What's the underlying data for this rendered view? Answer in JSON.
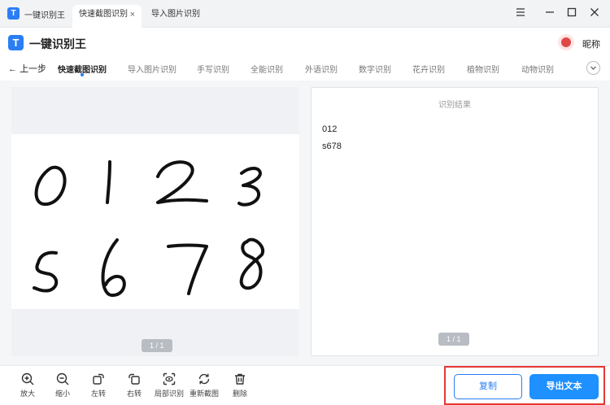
{
  "window": {
    "title": "一键识别王",
    "tabs": [
      {
        "label": "快速截图识别",
        "active": true
      },
      {
        "label": "导入图片识别",
        "active": false
      }
    ],
    "close_tab_glyph": "×"
  },
  "header": {
    "app_name": "一键识别王",
    "logo_letter": "T",
    "nickname": "昵称"
  },
  "nav": {
    "back_label": "上一步",
    "tabs": [
      "快速截图识别",
      "导入图片识别",
      "手写识别",
      "全能识别",
      "外语识别",
      "数字识别",
      "花卉识别",
      "植物识别",
      "动物识别"
    ]
  },
  "image_panel": {
    "page_indicator": "1 / 1"
  },
  "result_panel": {
    "title": "识别结果",
    "lines": [
      "012",
      "s678"
    ],
    "page_indicator": "1 / 1"
  },
  "toolbar": {
    "tools": [
      {
        "label": "放大",
        "icon": "zoom-in-icon"
      },
      {
        "label": "缩小",
        "icon": "zoom-out-icon"
      },
      {
        "label": "左转",
        "icon": "rotate-left-icon"
      },
      {
        "label": "右转",
        "icon": "rotate-right-icon"
      },
      {
        "label": "局部识别",
        "icon": "partial-recognize-icon"
      },
      {
        "label": "重新截图",
        "icon": "refresh-icon"
      },
      {
        "label": "删除",
        "icon": "trash-icon"
      }
    ],
    "copy_label": "复制",
    "export_label": "导出文本"
  },
  "colors": {
    "accent": "#1e90ff",
    "highlight": "#e53935"
  }
}
